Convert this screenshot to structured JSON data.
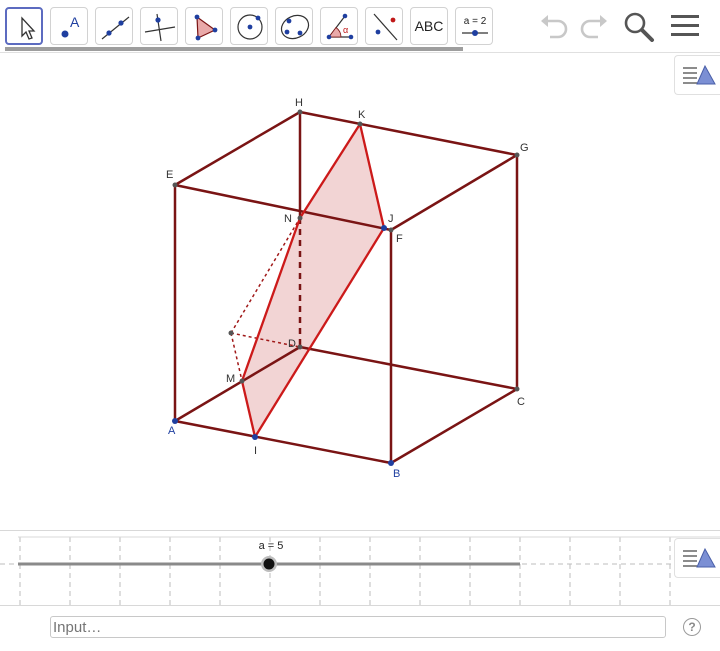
{
  "toolbar": {
    "tools": [
      {
        "name": "move-tool",
        "icon": "arrow-cursor-icon"
      },
      {
        "name": "point-tool",
        "icon": "point-icon",
        "label": "A"
      },
      {
        "name": "line-tool",
        "icon": "line-through-two-points-icon"
      },
      {
        "name": "perpendicular-line-tool",
        "icon": "perpendicular-line-icon"
      },
      {
        "name": "polygon-tool",
        "icon": "polygon-icon"
      },
      {
        "name": "circle-tool",
        "icon": "circle-with-center-icon"
      },
      {
        "name": "conic-tool",
        "icon": "ellipse-icon"
      },
      {
        "name": "angle-tool",
        "icon": "angle-icon",
        "label": "α"
      },
      {
        "name": "reflect-tool",
        "icon": "reflect-about-line-icon"
      },
      {
        "name": "text-tool",
        "icon": "text-icon",
        "label": "ABC"
      },
      {
        "name": "slider-tool",
        "icon": "slider-icon",
        "label": "a = 2"
      }
    ],
    "right_icons": [
      "undo-icon",
      "redo-icon",
      "search-icon",
      "menu-icon"
    ]
  },
  "graphics": {
    "style_bar_icon": "graphics-style-bar-icon",
    "points": [
      "H",
      "K",
      "G",
      "E",
      "N",
      "J",
      "F",
      "D",
      "M",
      "C",
      "A",
      "I",
      "B"
    ],
    "colors": {
      "cube_edge": "#7a1414",
      "section_edge": "#cc1a1a",
      "section_fill": "#f2d4d4"
    }
  },
  "slider_panel": {
    "label": "a = 5",
    "value": 5,
    "style_bar_icon": "algebra-style-bar-icon"
  },
  "input_bar": {
    "placeholder": "Input…",
    "help_label": "?"
  }
}
